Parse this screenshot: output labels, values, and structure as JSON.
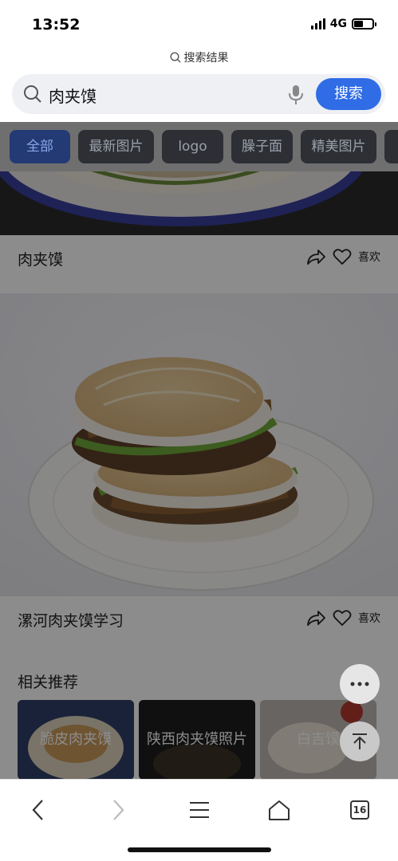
{
  "status": {
    "time": "13:52",
    "network": "4G",
    "battery_level": 0.5
  },
  "page_title": "搜索结果",
  "search": {
    "query": "肉夹馍",
    "button": "搜索"
  },
  "filter_chips": [
    "全部",
    "最新图片",
    "logo",
    "臊子面",
    "精美图片"
  ],
  "results": [
    {
      "title": "肉夹馍",
      "like_label": "喜欢"
    },
    {
      "title": "漯河肉夹馍学习",
      "like_label": "喜欢"
    }
  ],
  "related": {
    "title": "相关推荐",
    "items": [
      "脆皮肉夹馍",
      "陕西肉夹馍照片",
      "白吉馍"
    ]
  },
  "toolbar": {
    "tabs_count": "16"
  },
  "colors": {
    "accent": "#2f6ce5"
  }
}
